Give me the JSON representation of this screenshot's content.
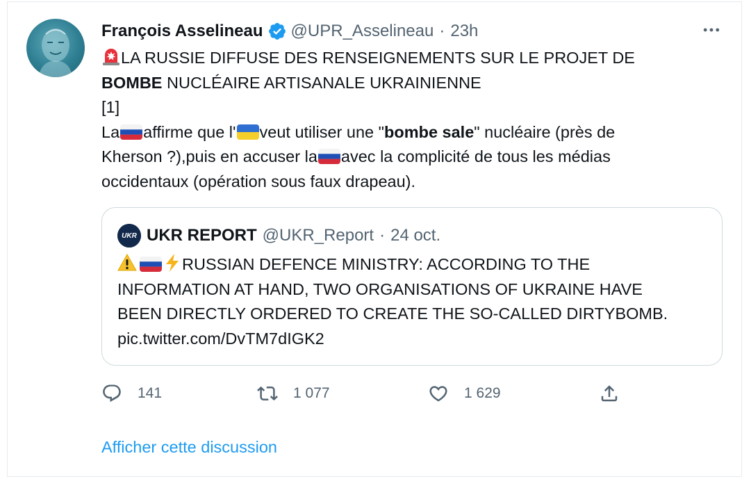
{
  "tweet": {
    "author_name": "François Asselineau",
    "author_handle": "@UPR_Asselineau",
    "separator": "·",
    "time": "23h",
    "more_label": "•••",
    "body": {
      "line1": "LA RUSSIE DIFFUSE DES RENSEIGNEMENTS SUR LE PROJET DE",
      "line2_bold": "BOMBE",
      "line2_rest": " NUCLÉAIRE ARTISANALE UKRAINIENNE",
      "line3": "[1]",
      "line4_a": "La",
      "line4_b": "affirme que l'",
      "line4_c": "veut utiliser une \"",
      "line4_bold": "bombe sale",
      "line4_d": "\" nucléaire (près de",
      "line5_a": "Kherson ?),puis en accuser la",
      "line5_b": "avec la complicité de tous les médias",
      "line6": "occidentaux (opération sous faux drapeau)."
    }
  },
  "quote": {
    "author_name": "UKR REPORT",
    "author_handle": "@UKR_Report",
    "separator": "·",
    "time": "24 oct.",
    "avatar_text": "UKR",
    "line1": "RUSSIAN DEFENCE MINISTRY: ACCORDING TO THE",
    "line2": "INFORMATION AT HAND, TWO ORGANISATIONS OF UKRAINE HAVE",
    "line3": "BEEN DIRECTLY ORDERED TO CREATE THE SO-CALLED DIRTYBOMB.",
    "link": "pic.twitter.com/DvTM7dIGK2"
  },
  "actions": {
    "replies": "141",
    "retweets": "1 077",
    "likes": "1 629"
  },
  "show_thread": "Afficher cette discussion",
  "colors": {
    "text": "#0f1419",
    "secondary": "#536471",
    "accent": "#1d9bf0",
    "border": "#cfd9de"
  },
  "icons": {
    "siren": "rotating-light-emoji",
    "warning": "warning-emoji",
    "bolt": "high-voltage-emoji",
    "russia_flag": "russia-flag",
    "ukraine_flag": "ukraine-flag"
  }
}
